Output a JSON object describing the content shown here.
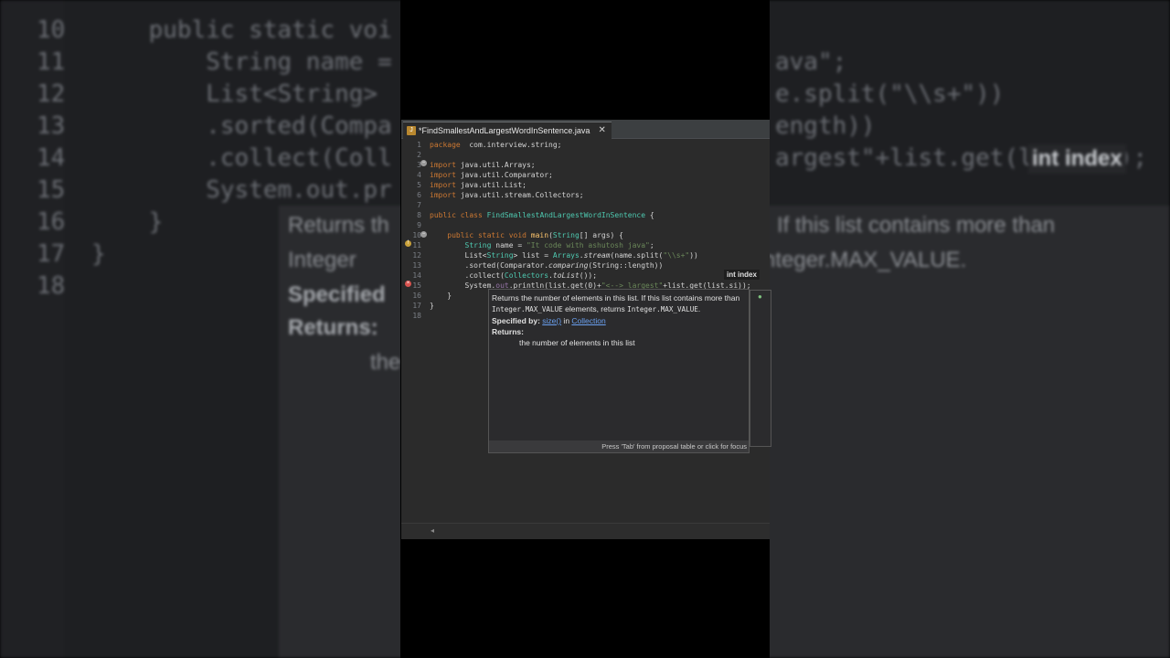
{
  "editor": {
    "tab_title": "*FindSmallestAndLargestWordInSentence.java",
    "tab_icon": "java-file-icon",
    "lines": [
      {
        "n": "1",
        "parts": [
          [
            "kw",
            "package"
          ],
          [
            "",
            "  com.interview.string;"
          ]
        ]
      },
      {
        "n": "2",
        "parts": []
      },
      {
        "n": "3",
        "parts": [
          [
            "kw",
            "import"
          ],
          [
            "",
            " java.util.Arrays;"
          ]
        ]
      },
      {
        "n": "4",
        "parts": [
          [
            "kw",
            "import"
          ],
          [
            "",
            " java.util.Comparator;"
          ]
        ]
      },
      {
        "n": "5",
        "parts": [
          [
            "kw",
            "import"
          ],
          [
            "",
            " java.util.List;"
          ]
        ]
      },
      {
        "n": "6",
        "parts": [
          [
            "kw",
            "import"
          ],
          [
            "",
            " java.util.stream.Collectors;"
          ]
        ]
      },
      {
        "n": "7",
        "parts": []
      },
      {
        "n": "8",
        "parts": [
          [
            "kw",
            "public"
          ],
          [
            "",
            " "
          ],
          [
            "kw",
            "class"
          ],
          [
            "",
            " "
          ],
          [
            "ty",
            "FindSmallestAndLargestWordInSentence"
          ],
          [
            "",
            " {"
          ]
        ]
      },
      {
        "n": "9",
        "parts": []
      },
      {
        "n": "10",
        "parts": [
          [
            "",
            "    "
          ],
          [
            "kw",
            "public static void"
          ],
          [
            "",
            " "
          ],
          [
            "fn",
            "main"
          ],
          [
            "",
            "("
          ],
          [
            "ty",
            "String"
          ],
          [
            "",
            "[] args) {"
          ]
        ]
      },
      {
        "n": "11",
        "parts": [
          [
            "",
            "        "
          ],
          [
            "ty",
            "String"
          ],
          [
            "",
            " name = "
          ],
          [
            "st",
            "\"It code with ashutosh java\""
          ],
          [
            "",
            ";"
          ]
        ]
      },
      {
        "n": "12",
        "parts": [
          [
            "",
            "        List<"
          ],
          [
            "ty",
            "String"
          ],
          [
            "",
            "> list = "
          ],
          [
            "ty",
            "Arrays"
          ],
          [
            "",
            "."
          ],
          [
            "it",
            "stream"
          ],
          [
            "",
            "(name.split("
          ],
          [
            "st",
            "\"\\\\s+\""
          ],
          [
            "",
            "))"
          ]
        ]
      },
      {
        "n": "13",
        "parts": [
          [
            "",
            "        .sorted(Comparator."
          ],
          [
            "it",
            "comparing"
          ],
          [
            "",
            "(String::length))"
          ]
        ]
      },
      {
        "n": "14",
        "parts": [
          [
            "",
            "        .collect("
          ],
          [
            "ty",
            "Collectors"
          ],
          [
            "",
            "."
          ],
          [
            "it",
            "toList"
          ],
          [
            "",
            "());"
          ]
        ]
      },
      {
        "n": "15",
        "parts": [
          [
            "",
            "        System."
          ],
          [
            "fld",
            "out"
          ],
          [
            "",
            ".println(list.get(0)+"
          ],
          [
            "st",
            "\"<--> largest\""
          ],
          [
            "",
            "+list.get(list.si));"
          ]
        ]
      },
      {
        "n": "16",
        "parts": [
          [
            "",
            "    }"
          ]
        ]
      },
      {
        "n": "17",
        "parts": [
          [
            "",
            "}"
          ]
        ]
      },
      {
        "n": "18",
        "parts": []
      }
    ]
  },
  "hint": {
    "text": "int index"
  },
  "popup": {
    "desc_1": "Returns the number of elements in this list. If this list contains more than",
    "desc_2_code": "Integer.MAX_VALUE",
    "desc_2_tail": " elements, returns ",
    "desc_2_code2": "Integer.MAX_VALUE",
    "desc_2_end": ".",
    "specified_by_label": "Specified by:",
    "specified_method": "size()",
    "specified_in": " in ",
    "specified_class": "Collection",
    "returns_label": "Returns:",
    "returns_text": "the number of elements in this list",
    "footer": "Press 'Tab' from proposal table or click for focus"
  },
  "background": {
    "lines": [
      {
        "n": "10",
        "text": "    public static voi"
      },
      {
        "n": "11",
        "text": "        String name ="
      },
      {
        "n": "12",
        "text": "        List<String>"
      },
      {
        "n": "13",
        "text": "        .sorted(Compa"
      },
      {
        "n": "14",
        "text": "        .collect(Coll"
      },
      {
        "n": "15",
        "text": "        System.out.pr"
      },
      {
        "n": "16",
        "text": "    }"
      },
      {
        "n": "17",
        "text": "}"
      },
      {
        "n": "18",
        "text": ""
      }
    ],
    "right_lines": [
      "ava\";",
      "e.split(\"\\\\s+\"))",
      "ength))",
      "argest\"+list.get(list.si);"
    ],
    "hint": "int index",
    "tip_1": "Returns th",
    "tip_1r": "If this list contains more than",
    "tip_2": "Integer",
    "tip_2r": "nteger.MAX_VALUE.",
    "tip_3": "Specified",
    "tip_4": "Returns:",
    "tip_5": "the"
  }
}
